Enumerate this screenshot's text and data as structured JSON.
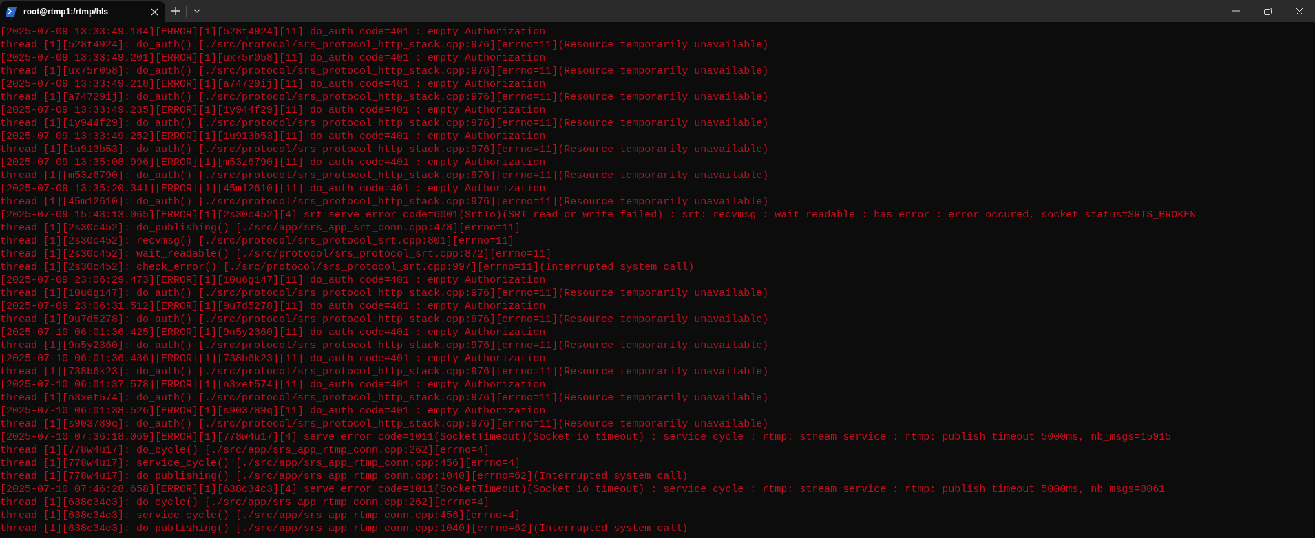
{
  "tabs": [
    {
      "title": "root@rtmp1:/rtmp/hls",
      "selected": true
    }
  ],
  "terminal": {
    "lines": [
      "[2025-07-09 13:33:49.184][ERROR][1][528t4924][11] do_auth code=401 : empty Authorization",
      "thread [1][528t4924]: do_auth() [./src/protocol/srs_protocol_http_stack.cpp:976][errno=11](Resource temporarily unavailable)",
      "[2025-07-09 13:33:49.201][ERROR][1][ux75r058][11] do_auth code=401 : empty Authorization",
      "thread [1][ux75r058]: do_auth() [./src/protocol/srs_protocol_http_stack.cpp:976][errno=11](Resource temporarily unavailable)",
      "[2025-07-09 13:33:49.218][ERROR][1][a74729ij][11] do_auth code=401 : empty Authorization",
      "thread [1][a74729ij]: do_auth() [./src/protocol/srs_protocol_http_stack.cpp:976][errno=11](Resource temporarily unavailable)",
      "[2025-07-09 13:33:49.235][ERROR][1][1y944f29][11] do_auth code=401 : empty Authorization",
      "thread [1][1y944f29]: do_auth() [./src/protocol/srs_protocol_http_stack.cpp:976][errno=11](Resource temporarily unavailable)",
      "[2025-07-09 13:33:49.252][ERROR][1][1u913b53][11] do_auth code=401 : empty Authorization",
      "thread [1][1u913b53]: do_auth() [./src/protocol/srs_protocol_http_stack.cpp:976][errno=11](Resource temporarily unavailable)",
      "[2025-07-09 13:35:08.996][ERROR][1][m53z6790][11] do_auth code=401 : empty Authorization",
      "thread [1][m53z6790]: do_auth() [./src/protocol/srs_protocol_http_stack.cpp:976][errno=11](Resource temporarily unavailable)",
      "[2025-07-09 13:35:20.341][ERROR][1][45m12610][11] do_auth code=401 : empty Authorization",
      "thread [1][45m12610]: do_auth() [./src/protocol/srs_protocol_http_stack.cpp:976][errno=11](Resource temporarily unavailable)",
      "[2025-07-09 15:43:13.065][ERROR][1][2s30c452][4] srt serve error code=6001(SrtIo)(SRT read or write failed) : srt: recvmsg : wait readable : has error : error occured, socket status=SRTS_BROKEN",
      "thread [1][2s30c452]: do_publishing() [./src/app/srs_app_srt_conn.cpp:478][errno=11]",
      "thread [1][2s30c452]: recvmsg() [./src/protocol/srs_protocol_srt.cpp:801][errno=11]",
      "thread [1][2s30c452]: wait_readable() [./src/protocol/srs_protocol_srt.cpp:872][errno=11]",
      "thread [1][2s30c452]: check_error() [./src/protocol/srs_protocol_srt.cpp:997][errno=11](Interrupted system call)",
      "[2025-07-09 23:06:29.473][ERROR][1][10u6g147][11] do_auth code=401 : empty Authorization",
      "thread [1][10u6g147]: do_auth() [./src/protocol/srs_protocol_http_stack.cpp:976][errno=11](Resource temporarily unavailable)",
      "[2025-07-09 23:06:31.512][ERROR][1][9u7d5278][11] do_auth code=401 : empty Authorization",
      "thread [1][9u7d5278]: do_auth() [./src/protocol/srs_protocol_http_stack.cpp:976][errno=11](Resource temporarily unavailable)",
      "[2025-07-10 06:01:36.425][ERROR][1][9n5y2360][11] do_auth code=401 : empty Authorization",
      "thread [1][9n5y2360]: do_auth() [./src/protocol/srs_protocol_http_stack.cpp:976][errno=11](Resource temporarily unavailable)",
      "[2025-07-10 06:01:36.436][ERROR][1][738b6k23][11] do_auth code=401 : empty Authorization",
      "thread [1][738b6k23]: do_auth() [./src/protocol/srs_protocol_http_stack.cpp:976][errno=11](Resource temporarily unavailable)",
      "[2025-07-10 06:01:37.578][ERROR][1][n3xet574][11] do_auth code=401 : empty Authorization",
      "thread [1][n3xet574]: do_auth() [./src/protocol/srs_protocol_http_stack.cpp:976][errno=11](Resource temporarily unavailable)",
      "[2025-07-10 06:01:38.526][ERROR][1][s903789q][11] do_auth code=401 : empty Authorization",
      "thread [1][s903789q]: do_auth() [./src/protocol/srs_protocol_http_stack.cpp:976][errno=11](Resource temporarily unavailable)",
      "[2025-07-10 07:36:18.069][ERROR][1][778w4u17][4] serve error code=1011(SocketTimeout)(Socket io timeout) : service cycle : rtmp: stream service : rtmp: publish timeout 5000ms, nb_msgs=15915",
      "thread [1][778w4u17]: do_cycle() [./src/app/srs_app_rtmp_conn.cpp:262][errno=4]",
      "thread [1][778w4u17]: service_cycle() [./src/app/srs_app_rtmp_conn.cpp:456][errno=4]",
      "thread [1][778w4u17]: do_publishing() [./src/app/srs_app_rtmp_conn.cpp:1040][errno=62](Interrupted system call)",
      "[2025-07-10 07:46:28.658][ERROR][1][638c34c3][4] serve error code=1011(SocketTimeout)(Socket io timeout) : service cycle : rtmp: stream service : rtmp: publish timeout 5000ms, nb_msgs=8061",
      "thread [1][638c34c3]: do_cycle() [./src/app/srs_app_rtmp_conn.cpp:262][errno=4]",
      "thread [1][638c34c3]: service_cycle() [./src/app/srs_app_rtmp_conn.cpp:456][errno=4]",
      "thread [1][638c34c3]: do_publishing() [./src/app/srs_app_rtmp_conn.cpp:1040][errno=62](Interrupted system call)"
    ]
  }
}
